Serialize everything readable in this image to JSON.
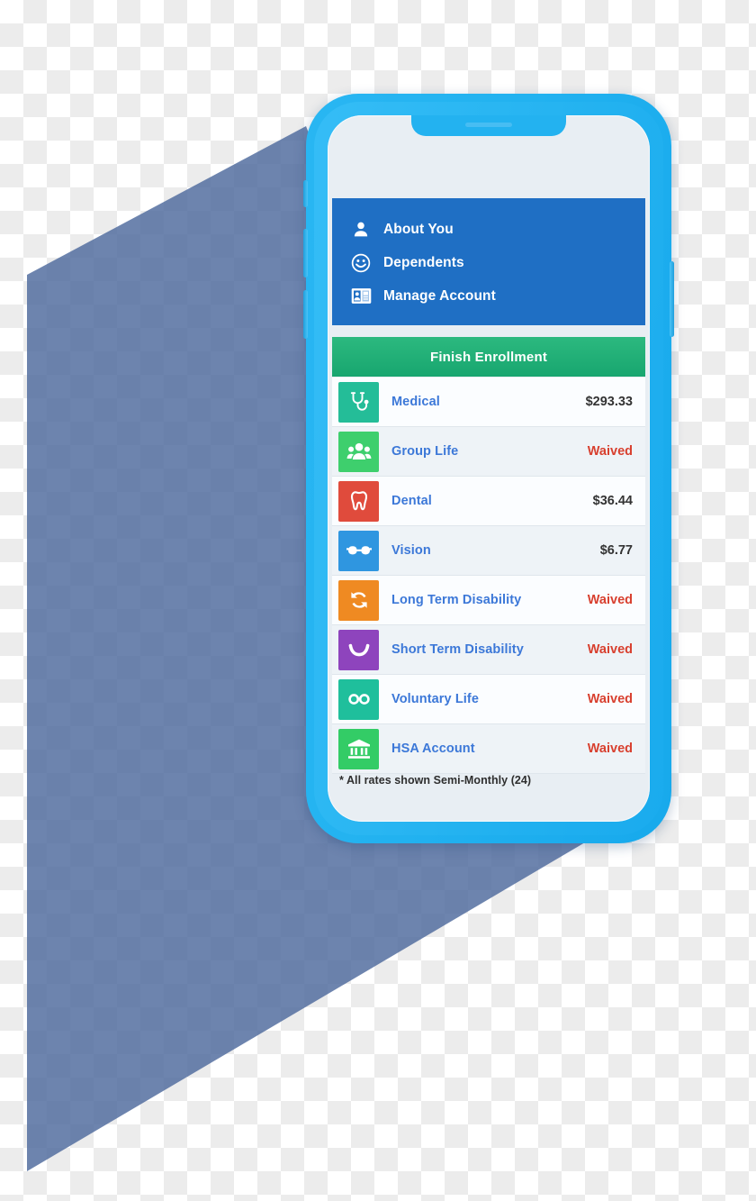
{
  "nav": {
    "items": [
      {
        "label": "About You",
        "icon": "person-icon"
      },
      {
        "label": "Dependents",
        "icon": "smiley-face-icon"
      },
      {
        "label": "Manage Account",
        "icon": "id-card-icon"
      }
    ]
  },
  "cta": {
    "finish_label": "Finish Enrollment",
    "color": "#21b07a"
  },
  "benefits": {
    "rows": [
      {
        "name": "Medical",
        "value": "$293.33",
        "state": "amount",
        "icon": "stethoscope-icon",
        "color": "#24bd98"
      },
      {
        "name": "Group Life",
        "value": "Waived",
        "state": "waived",
        "icon": "group-people-icon",
        "color": "#3ecf6d"
      },
      {
        "name": "Dental",
        "value": "$36.44",
        "state": "amount",
        "icon": "tooth-icon",
        "color": "#e04b3c"
      },
      {
        "name": "Vision",
        "value": "$6.77",
        "state": "amount",
        "icon": "glasses-icon",
        "color": "#2f96e0"
      },
      {
        "name": "Long Term Disability",
        "value": "Waived",
        "state": "waived",
        "icon": "refresh-icon",
        "color": "#ef8a22"
      },
      {
        "name": "Short Term Disability",
        "value": "Waived",
        "state": "waived",
        "icon": "smile-curve-icon",
        "color": "#8e44bd"
      },
      {
        "name": "Voluntary Life",
        "value": "Waived",
        "state": "waived",
        "icon": "infinity-icon",
        "color": "#1fbf9c"
      },
      {
        "name": "HSA Account",
        "value": "Waived",
        "state": "waived",
        "icon": "bank-icon",
        "color": "#33cc66"
      }
    ]
  },
  "footnote": {
    "text": "* All rates shown Semi-Monthly (24)"
  },
  "colors": {
    "nav_panel": "#1f6fc4",
    "phone_bezel": "#23b2f0",
    "screen_bg": "#e8eef3",
    "waived_text": "#d8402f",
    "amount_text": "#333333",
    "row_label": "#3c78d8",
    "shadow": "#4d699c"
  }
}
